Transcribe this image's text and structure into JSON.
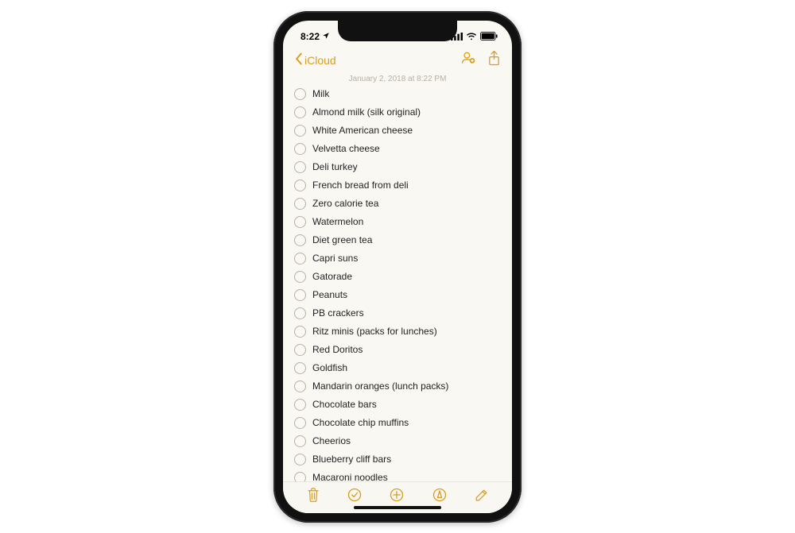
{
  "status": {
    "time": "8:22",
    "location_icon": "location-arrow"
  },
  "nav": {
    "back_label": "iCloud"
  },
  "note": {
    "timestamp": "January 2, 2018 at 8:22 PM",
    "items": [
      "Milk",
      "Almond milk (silk original)",
      "White American cheese",
      "Velvetta cheese",
      "Deli turkey",
      "French bread from deli",
      "Zero calorie tea",
      "Watermelon",
      "Diet green tea",
      "Capri suns",
      "Gatorade",
      "Peanuts",
      "PB crackers",
      "Ritz minis (packs for lunches)",
      "Red Doritos",
      "Goldfish",
      "Mandarin oranges (lunch packs)",
      "Chocolate bars",
      "Chocolate chip muffins",
      "Cheerios",
      "Blueberry cliff bars",
      "Macaroni noodles"
    ]
  },
  "colors": {
    "accent": "#d99e1f"
  }
}
